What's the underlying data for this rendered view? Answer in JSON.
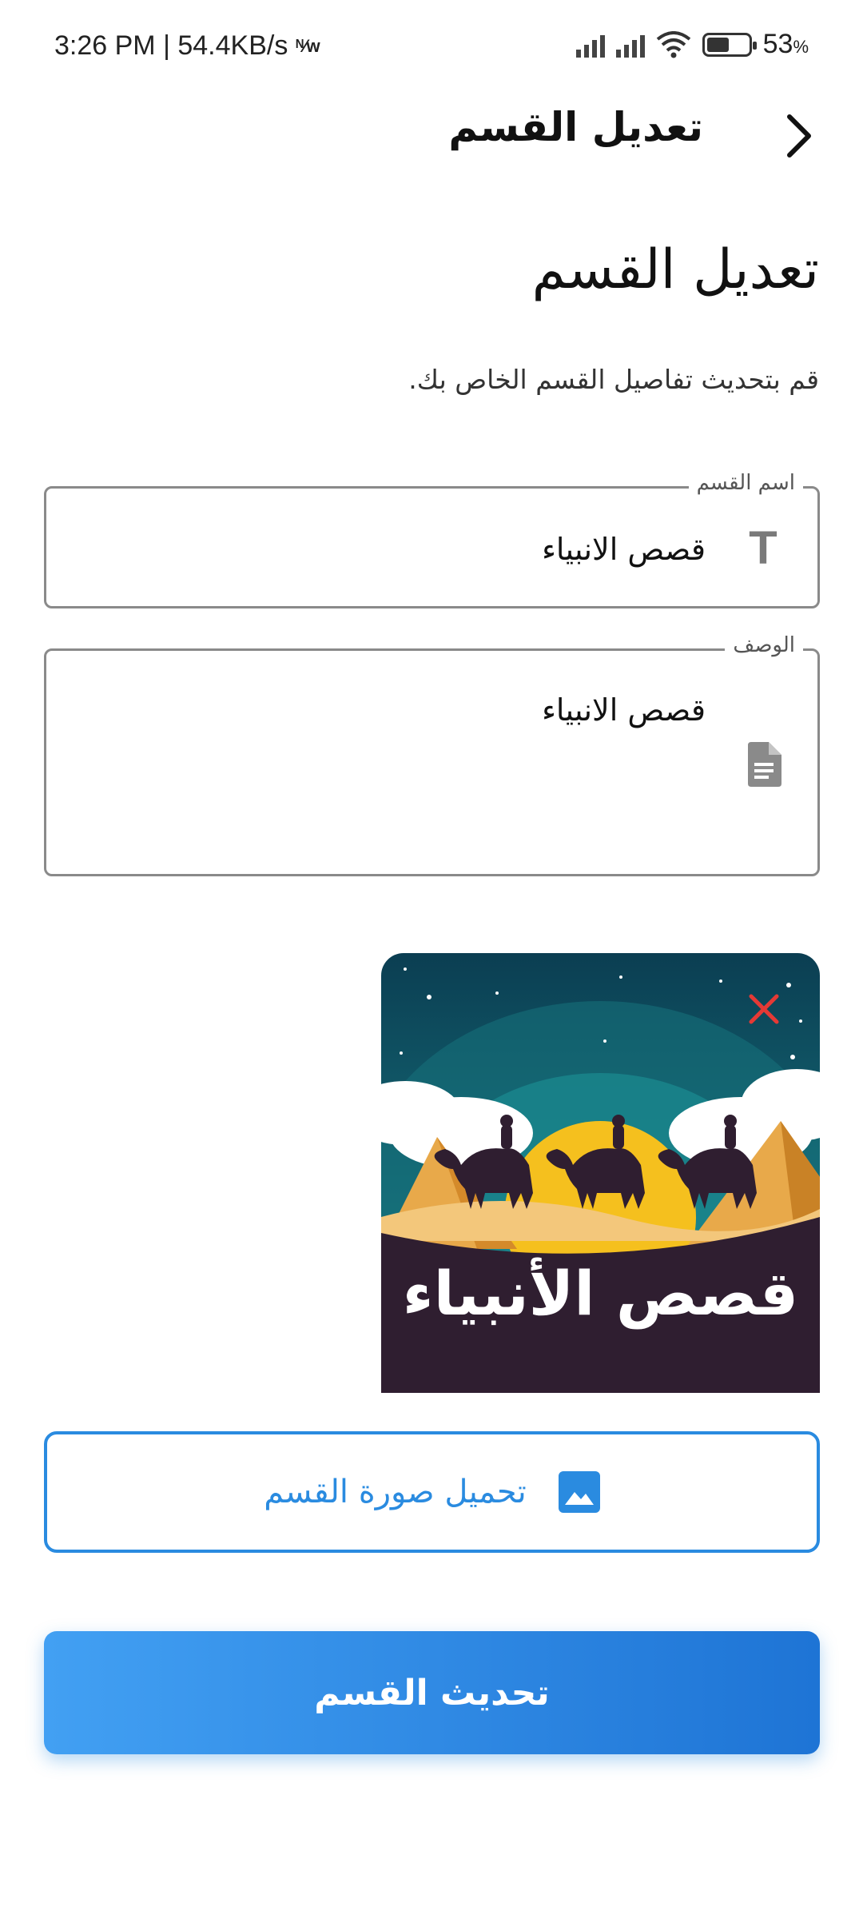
{
  "status_bar": {
    "time_speed": "3:26 PM | 54.4KB/s",
    "network_glyph": "ᴺ⁄ᴡ",
    "battery_percent": "53",
    "battery_unit": "%",
    "battery_level": 0.53
  },
  "app_bar": {
    "title": "تعديل القسم",
    "back_icon": "chevron-right-icon"
  },
  "page": {
    "heading": "تعديل القسم",
    "subtitle": "قم بتحديث تفاصيل القسم الخاص بك."
  },
  "form": {
    "name_field": {
      "label": "اسم القسم",
      "value": "قصص الانبياء",
      "icon": "text-icon",
      "icon_glyph": "T"
    },
    "description_field": {
      "label": "الوصف",
      "value": "قصص الانبياء",
      "icon": "document-icon"
    }
  },
  "image": {
    "caption": "قصص الأنبياء",
    "remove_icon": "close-icon",
    "colors": {
      "sky_top": "#0e4a5c",
      "sky_bottom": "#1a8a90",
      "sun": "#f5c01e",
      "sand": "#e8a94a",
      "ground": "#2f1e30",
      "remove": "#e53935"
    }
  },
  "buttons": {
    "upload_label": "تحميل صورة القسم",
    "upload_icon": "image-icon",
    "update_label": "تحديث القسم"
  },
  "colors": {
    "accent": "#2a8be0",
    "accent_dark": "#1e74d5"
  }
}
